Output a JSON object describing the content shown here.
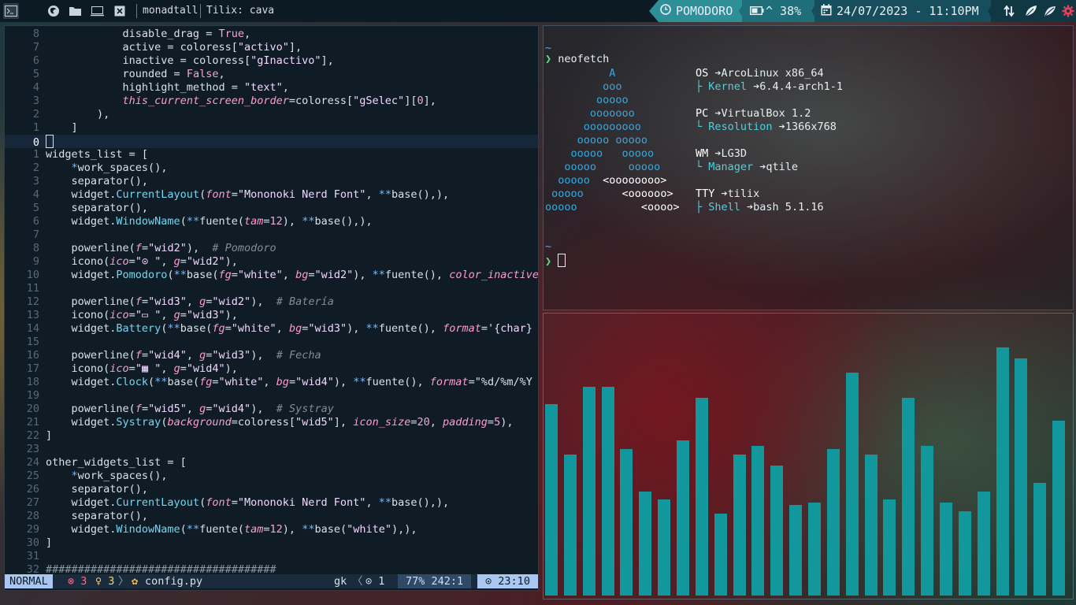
{
  "topbar": {
    "window_title": "monadtall",
    "active_window": "Tilix: cava",
    "pomodoro": "POMODORO",
    "battery": "^ 38%",
    "datetime": "24/07/2023 - 11:10PM",
    "workspace_icons": [
      "terminal-icon",
      "firefox-icon",
      "folder-icon",
      "monitor-icon",
      "close-box-icon"
    ],
    "tray_icons": [
      "network-icon",
      "leaf-icon",
      "leaf-icon-2",
      "gear-icon"
    ],
    "colors": {
      "pomodoro": "#2e8f97",
      "battery": "#1f6f7a",
      "date": "#174e5e",
      "tray": "#0f3744"
    }
  },
  "editor": {
    "lines": [
      {
        "n": "8",
        "text": "            disable_drag = True,"
      },
      {
        "n": "7",
        "text": "            active = coloress[\"activo\"],"
      },
      {
        "n": "6",
        "text": "            inactive = coloress[\"gInactivo\"],"
      },
      {
        "n": "5",
        "text": "            rounded = False,"
      },
      {
        "n": "4",
        "text": "            highlight_method = \"text\","
      },
      {
        "n": "3",
        "text": "            this_current_screen_border=coloress[\"gSelec\"][0],"
      },
      {
        "n": "2",
        "text": "        ),"
      },
      {
        "n": "1",
        "text": "    ]"
      },
      {
        "n": "0",
        "text": ""
      },
      {
        "n": "1",
        "text": "widgets_list = ["
      },
      {
        "n": "2",
        "text": "    *work_spaces(),"
      },
      {
        "n": "3",
        "text": "    separator(),"
      },
      {
        "n": "4",
        "text": "    widget.CurrentLayout(font=\"Mononoki Nerd Font\", **base(),),"
      },
      {
        "n": "5",
        "text": "    separator(),"
      },
      {
        "n": "6",
        "text": "    widget.WindowName(**fuente(tam=12), **base(),),"
      },
      {
        "n": "7",
        "text": ""
      },
      {
        "n": "8",
        "text": "    powerline(f=\"wid2\"),  # Pomodoro"
      },
      {
        "n": "9",
        "text": "    icono(ico=\"⊙ \", g=\"wid2\"),"
      },
      {
        "n": "10",
        "text": "    widget.Pomodoro(**base(fg=\"white\", bg=\"wid2\"), **fuente(), color_inactive="
      },
      {
        "n": "11",
        "text": ""
      },
      {
        "n": "12",
        "text": "    powerline(f=\"wid3\", g=\"wid2\"),  # Batería"
      },
      {
        "n": "13",
        "text": "    icono(ico=\"▭ \", g=\"wid3\"),"
      },
      {
        "n": "14",
        "text": "    widget.Battery(**base(fg=\"white\", bg=\"wid3\"), **fuente(), format='{char} {"
      },
      {
        "n": "15",
        "text": ""
      },
      {
        "n": "16",
        "text": "    powerline(f=\"wid4\", g=\"wid3\"),  # Fecha"
      },
      {
        "n": "17",
        "text": "    icono(ico=\"▦ \", g=\"wid4\"),"
      },
      {
        "n": "18",
        "text": "    widget.Clock(**base(fg=\"white\", bg=\"wid4\"), **fuente(), format=\"%d/%m/%Y -"
      },
      {
        "n": "19",
        "text": ""
      },
      {
        "n": "20",
        "text": "    powerline(f=\"wid5\", g=\"wid4\"),  # Systray"
      },
      {
        "n": "21",
        "text": "    widget.Systray(background=coloress[\"wid5\"], icon_size=20, padding=5),"
      },
      {
        "n": "22",
        "text": "]"
      },
      {
        "n": "23",
        "text": ""
      },
      {
        "n": "24",
        "text": "other_widgets_list = ["
      },
      {
        "n": "25",
        "text": "    *work_spaces(),"
      },
      {
        "n": "26",
        "text": "    separator(),"
      },
      {
        "n": "27",
        "text": "    widget.CurrentLayout(font=\"Mononoki Nerd Font\", **base(),),"
      },
      {
        "n": "28",
        "text": "    separator(),"
      },
      {
        "n": "29",
        "text": "    widget.WindowName(**fuente(tam=12), **base(\"white\"),),"
      },
      {
        "n": "30",
        "text": "]"
      },
      {
        "n": "31",
        "text": ""
      },
      {
        "n": "32",
        "text": "####################################"
      }
    ],
    "cursor_line_index": 8,
    "status": {
      "mode": "NORMAL",
      "errors": "⊗ 3",
      "hints": "♀ 3",
      "separator": "〉",
      "file_icon": "✿",
      "filename": "config.py",
      "git": "gk",
      "arrow": "〈",
      "buffers": "⊙ 1",
      "position": "77% 242:1",
      "time": "⊙ 23:10"
    }
  },
  "neofetch": {
    "prompt_tilde": "~",
    "prompt_arrow": "❯",
    "command": "neofetch",
    "logo": [
      "          A",
      "         ooo",
      "        ooooo",
      "       ooooooo",
      "      ooooooooo",
      "     ooooo ooooo",
      "    ooooo   ooooo",
      "   ooooo     ooooo",
      "  ooooo  <oooooooo>",
      " ooooo      <oooooo>",
      "ooooo          <oooo>"
    ],
    "info": [
      {
        "key": "OS",
        "arrow": "➔",
        "value": "ArcoLinux x86_64",
        "sub": false
      },
      {
        "key": "├ Kernel",
        "arrow": "➔",
        "value": "6.4.4-arch1-1",
        "sub": true
      },
      {
        "key": "",
        "arrow": "",
        "value": "",
        "sub": false
      },
      {
        "key": "PC",
        "arrow": "➔",
        "value": "VirtualBox 1.2",
        "sub": false
      },
      {
        "key": "└ Resolution",
        "arrow": "➔",
        "value": "1366x768",
        "sub": true
      },
      {
        "key": "",
        "arrow": "",
        "value": "",
        "sub": false
      },
      {
        "key": "WM",
        "arrow": "➔",
        "value": "LG3D",
        "sub": false
      },
      {
        "key": "└ Manager",
        "arrow": "➔",
        "value": "qtile",
        "sub": true
      },
      {
        "key": "",
        "arrow": "",
        "value": "",
        "sub": false
      },
      {
        "key": "TTY",
        "arrow": "➔",
        "value": "tilix",
        "sub": false
      },
      {
        "key": "├ Shell",
        "arrow": "➔",
        "value": "bash 5.1.16",
        "sub": true
      }
    ],
    "second_prompt_tilde": "~",
    "second_prompt_arrow": "❯"
  },
  "cava": {
    "bar_color": "#12979c",
    "levels": [
      0.68,
      0.5,
      0.74,
      0.74,
      0.52,
      0.37,
      0.34,
      0.55,
      0.7,
      0.29,
      0.5,
      0.53,
      0.46,
      0.32,
      0.33,
      0.52,
      0.79,
      0.5,
      0.34,
      0.7,
      0.53,
      0.33,
      0.3,
      0.37,
      0.88,
      0.84,
      0.4,
      0.62
    ]
  }
}
